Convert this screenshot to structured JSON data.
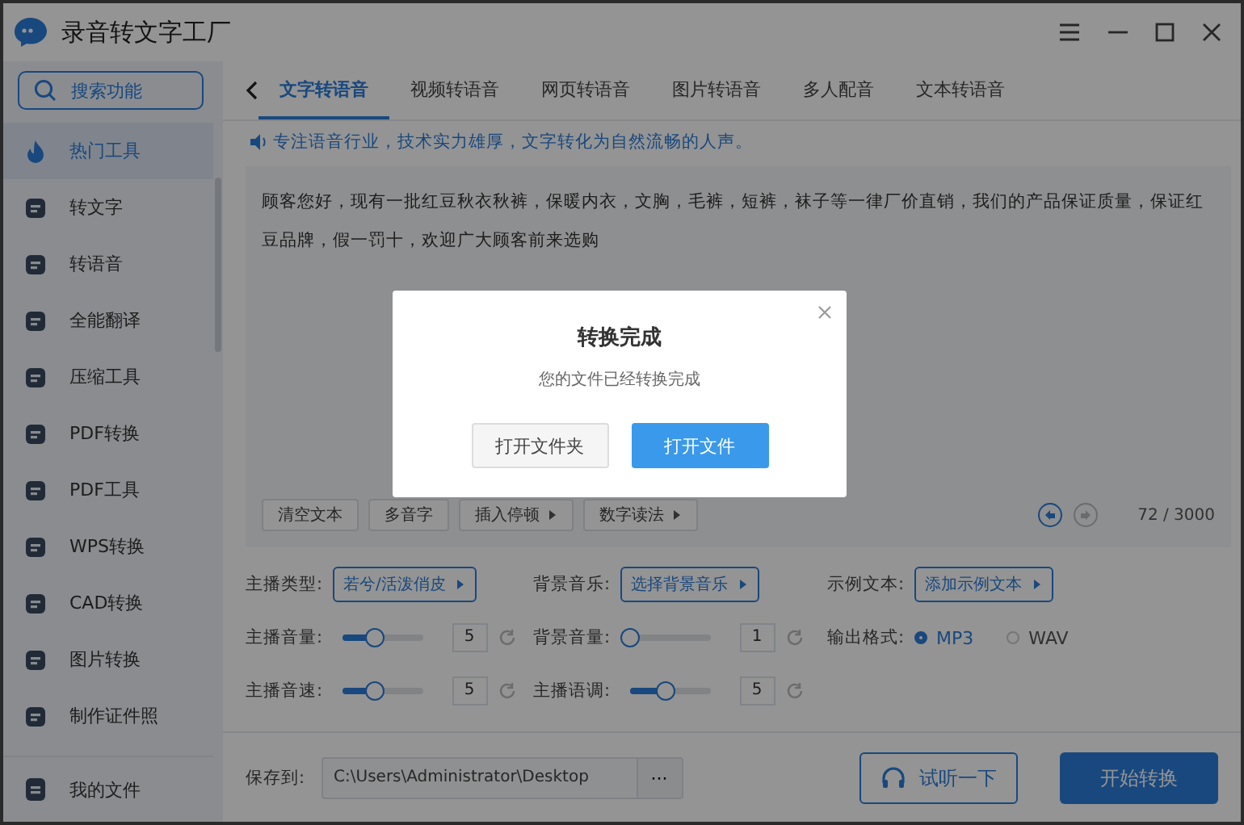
{
  "window": {
    "title": "录音转文字工厂"
  },
  "sidebar": {
    "search": {
      "placeholder": "搜索功能"
    },
    "items": [
      {
        "label": "热门工具",
        "selected": true
      },
      {
        "label": "转文字",
        "selected": false
      },
      {
        "label": "转语音",
        "selected": false
      },
      {
        "label": "全能翻译",
        "selected": false
      },
      {
        "label": "压缩工具",
        "selected": false
      },
      {
        "label": "PDF转换",
        "selected": false
      },
      {
        "label": "PDF工具",
        "selected": false
      },
      {
        "label": "WPS转换",
        "selected": false
      },
      {
        "label": "CAD转换",
        "selected": false
      },
      {
        "label": "图片转换",
        "selected": false
      },
      {
        "label": "制作证件照",
        "selected": false
      }
    ],
    "footer_item": {
      "label": "我的文件"
    }
  },
  "tabs": [
    {
      "label": "文字转语音",
      "selected": true
    },
    {
      "label": "视频转语音",
      "selected": false
    },
    {
      "label": "网页转语音",
      "selected": false
    },
    {
      "label": "图片转语音",
      "selected": false
    },
    {
      "label": "多人配音",
      "selected": false
    },
    {
      "label": "文本转语音",
      "selected": false
    }
  ],
  "notice": "专注语音行业，技术实力雄厚，文字转化为自然流畅的人声。",
  "editor": {
    "text": "顾客您好，现有一批红豆秋衣秋裤，保暖内衣，文胸，毛裤，短裤，袜子等一律厂价直销，我们的产品保证质量，保证红豆品牌，假一罚十，欢迎广大顾客前来选购",
    "tools": [
      {
        "label": "清空文本",
        "kind": "plain"
      },
      {
        "label": "多音字",
        "kind": "plain"
      },
      {
        "label": "插入停顿",
        "kind": "dropdown"
      },
      {
        "label": "数字读法",
        "kind": "dropdown"
      }
    ],
    "count": "72 / 3000"
  },
  "settings": [
    {
      "kind": "picker",
      "label": "主播类型:",
      "value": "若兮/活泼俏皮"
    },
    {
      "kind": "picker",
      "label": "背景音乐:",
      "value": "选择背景音乐"
    },
    {
      "kind": "picker",
      "label": "示例文本:",
      "value": "添加示例文本"
    },
    {
      "kind": "slider",
      "label": "主播音量:",
      "level": 0.4,
      "value": "5"
    },
    {
      "kind": "slider",
      "label": "背景音量:",
      "level": 0,
      "value": "1"
    },
    {
      "kind": "radio",
      "label": "输出格式:",
      "options": [
        {
          "label": "MP3",
          "selected": true
        },
        {
          "label": "WAV",
          "selected": false
        }
      ]
    },
    {
      "kind": "slider",
      "label": "主播音速:",
      "level": 0.4,
      "value": "5"
    },
    {
      "kind": "slider",
      "label": "主播语调:",
      "level": 0.45,
      "value": "5"
    }
  ],
  "footer": {
    "label": "保存到:",
    "path": "C:\\Users\\Administrator\\Desktop",
    "browse": "···",
    "preview": "试听一下",
    "start": "开始转换"
  },
  "dialog": {
    "title": "转换完成",
    "message": "您的文件已经转换完成",
    "buttons": [
      {
        "label": "打开文件夹",
        "kind": "secondary"
      },
      {
        "label": "打开文件",
        "kind": "primary"
      }
    ]
  }
}
